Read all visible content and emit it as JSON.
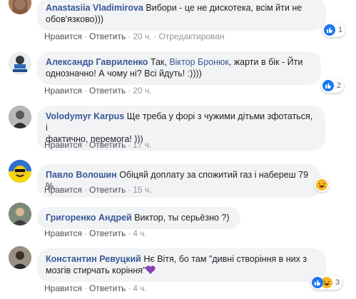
{
  "comments": [
    {
      "author": "Anastasiia Vladimirova",
      "text": " Вибори - це не дискотека, всім йти не обов'язково)))",
      "line1": " Вибори - це не дискотека, всім йти не",
      "line2": "обов'язково)))",
      "actions": {
        "like": "Нравится",
        "reply": "Ответить",
        "time": "20 ч.",
        "edited": "Отредактирован"
      },
      "reactions": {
        "type": "like",
        "count": "1"
      }
    },
    {
      "author": "Александр Гавриленко",
      "pre": " Так, ",
      "mention": "Віктор Бронюк",
      "post": ", жарти в бік - Йти",
      "line2": "однозначно! А чому ні? Всі йдуть! :))))",
      "actions": {
        "like": "Нравится",
        "reply": "Ответить",
        "time": "20 ч."
      },
      "reactions": {
        "type": "like",
        "count": "2"
      }
    },
    {
      "author": "Volodymyr Karpus",
      "line1": " Ще треба у форі з чужими дітьми зфотаться, і",
      "line2": "фактично, перемога! )))",
      "actions": {
        "like": "Нравится",
        "reply": "Ответить",
        "time": "17 ч."
      }
    },
    {
      "author": "Павло Волошин",
      "line1": " Обіцяй доплату за спожитий газ і набереш 79 %.",
      "actions": {
        "like": "Нравится",
        "reply": "Ответить",
        "time": "15 ч."
      },
      "reactions": {
        "type": "haha",
        "count": ""
      }
    },
    {
      "author": "Григоренко Андрей",
      "line1": " Виктор, ты серьёзно ?)",
      "actions": {
        "like": "Нравится",
        "reply": "Ответить",
        "time": "4 ч."
      }
    },
    {
      "author": "Константин Ревуцкий",
      "line1": " Нє Вітя, бо там \"дивні створіння в них з",
      "line2": "мозгів стирчать коріння\"",
      "actions": {
        "like": "Нравится",
        "reply": "Ответить",
        "time": "4 ч."
      },
      "reactions": {
        "type": "like+haha",
        "count": "3"
      }
    }
  ],
  "icons": {
    "like": "thumbs-up-icon",
    "haha": "laughing-face-icon",
    "heart": "purple-heart-icon"
  },
  "colors": {
    "author": "#385898",
    "bubble": "#f2f3f5",
    "action_text": "#4b4f56",
    "meta_text": "#90949c",
    "like_blue": "#1877f2",
    "haha_yellow": "#f7b928",
    "heart_purple": "#8e3fb8"
  }
}
